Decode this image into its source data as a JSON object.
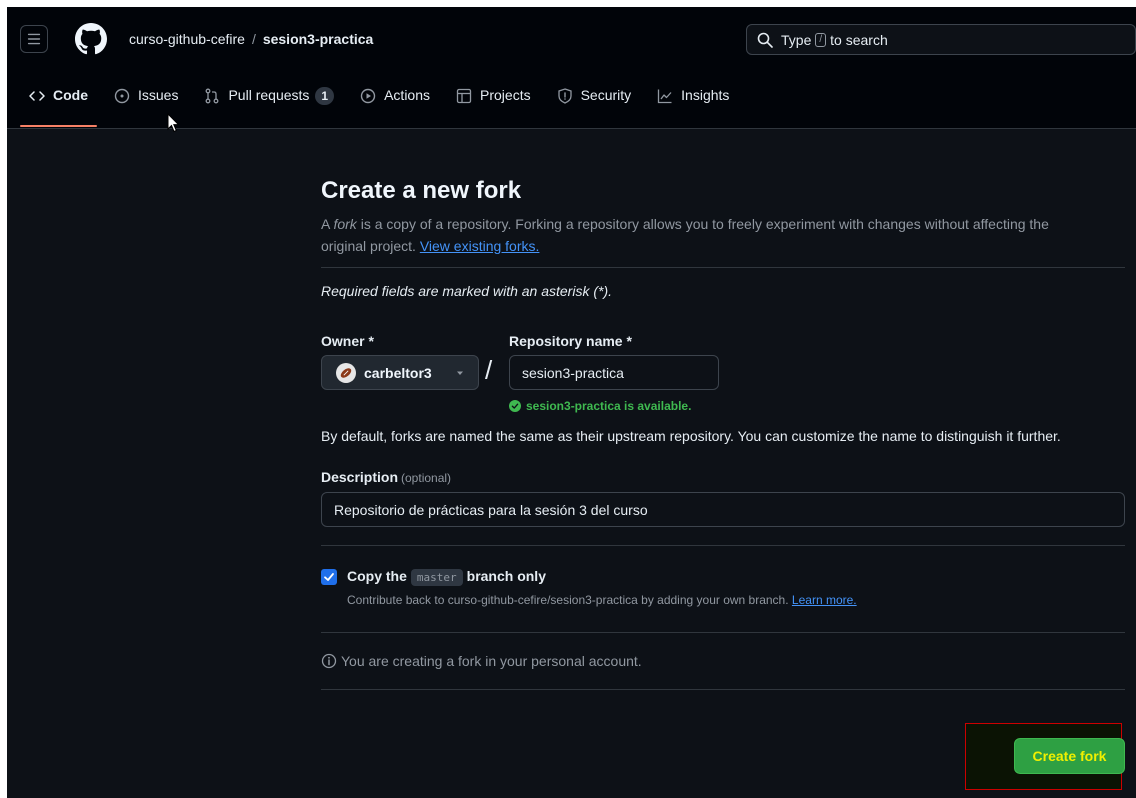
{
  "header": {
    "org": "curso-github-cefire",
    "separator": "/",
    "repo": "sesion3-practica",
    "search": {
      "prefix": "Type",
      "key": "/",
      "suffix": "to search"
    }
  },
  "tabs": [
    {
      "label": "Code",
      "icon": "code-icon"
    },
    {
      "label": "Issues",
      "icon": "issue-icon"
    },
    {
      "label": "Pull requests",
      "icon": "pull-request-icon",
      "count": "1"
    },
    {
      "label": "Actions",
      "icon": "play-icon"
    },
    {
      "label": "Projects",
      "icon": "table-icon"
    },
    {
      "label": "Security",
      "icon": "shield-icon"
    },
    {
      "label": "Insights",
      "icon": "graph-icon"
    }
  ],
  "form": {
    "title": "Create a new fork",
    "intro": {
      "fork_word": "fork",
      "text_before": "A ",
      "text_after": " is a copy of a repository. Forking a repository allows you to freely experiment with changes without affecting the original project.",
      "link": "View existing forks."
    },
    "required_note": "Required fields are marked with an asterisk (*).",
    "owner_label": "Owner *",
    "owner_value": "carbeltor3",
    "slash": "/",
    "repo_label": "Repository name *",
    "repo_value": "sesion3-practica",
    "available": "sesion3-practica is available.",
    "default_note": "By default, forks are named the same as their upstream repository. You can customize the name to distinguish it further.",
    "description_label": "Description",
    "description_optional": "(optional)",
    "description_value": "Repositorio de prácticas para la sesión 3 del curso",
    "copy_before": "Copy the",
    "copy_branch": "master",
    "copy_after": "branch only",
    "copy_checked": true,
    "copy_help": "Contribute back to curso-github-cefire/sesion3-practica by adding your own branch.",
    "copy_help_link": "Learn more.",
    "personal_note": "You are creating a fork in your personal account.",
    "create_button": "Create fork"
  },
  "colors": {
    "background": "#0d1117",
    "header": "#010409",
    "accent_underline": "#f78166",
    "link": "#4493f8",
    "success": "#3fb950",
    "create_button": "#2ea043",
    "checkbox": "#1f6feb"
  }
}
